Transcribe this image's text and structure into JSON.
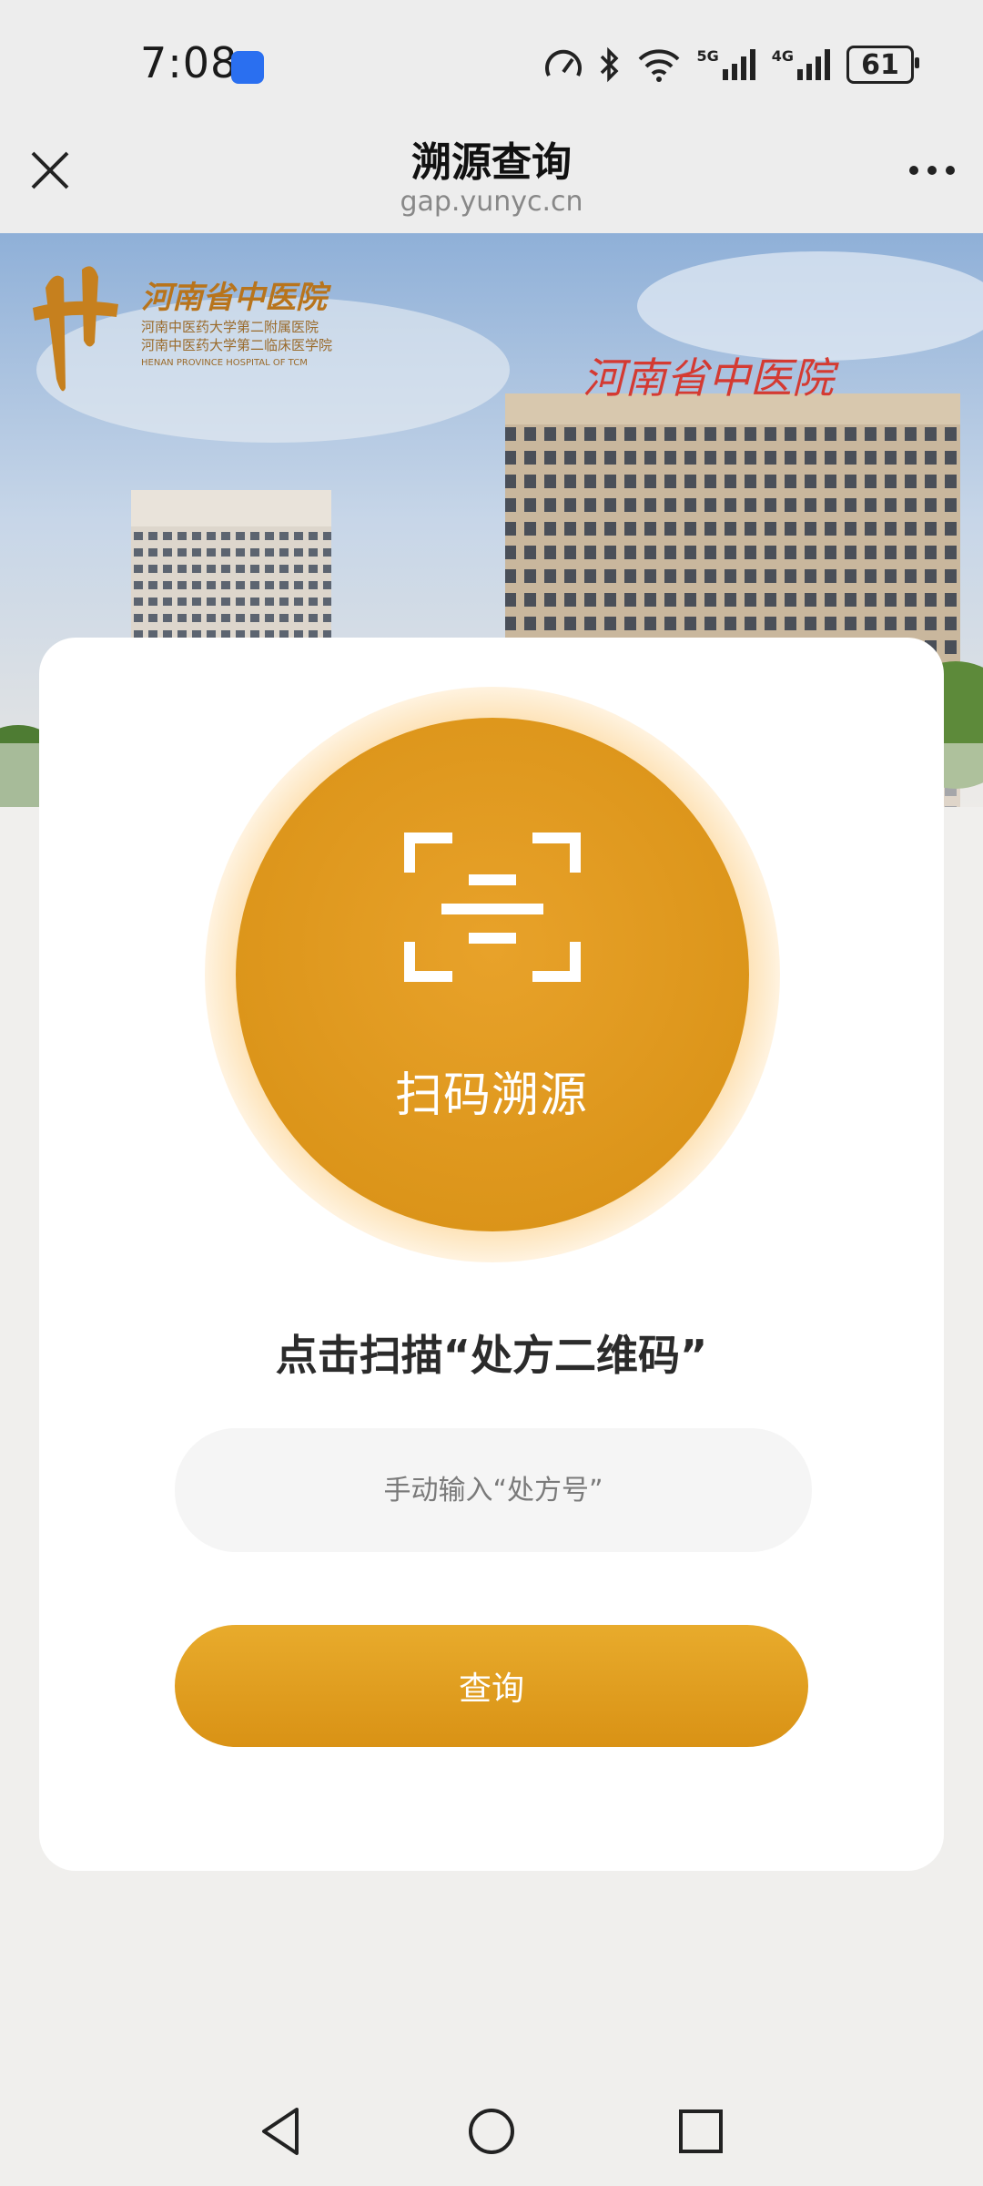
{
  "status_bar": {
    "time": "7:08",
    "network_5g": "5G",
    "network_4g": "4G",
    "battery": "61"
  },
  "header": {
    "title": "溯源查询",
    "subtitle": "gap.yunyc.cn"
  },
  "banner": {
    "logo_name": "河南省中医院",
    "logo_line1": "河南中医药大学第二附属医院",
    "logo_line2": "河南中医药大学第二临床医学院",
    "logo_line3": "HENAN PROVINCE HOSPITAL OF TCM",
    "building_sign": "河南省中医院"
  },
  "card": {
    "scan_label": "扫码溯源",
    "instruction": "点击扫描“处方二维码”",
    "input_placeholder": "手动输入“处方号”",
    "query_label": "查询"
  },
  "colors": {
    "accent": "#de9a1f",
    "background": "#f0efed"
  }
}
